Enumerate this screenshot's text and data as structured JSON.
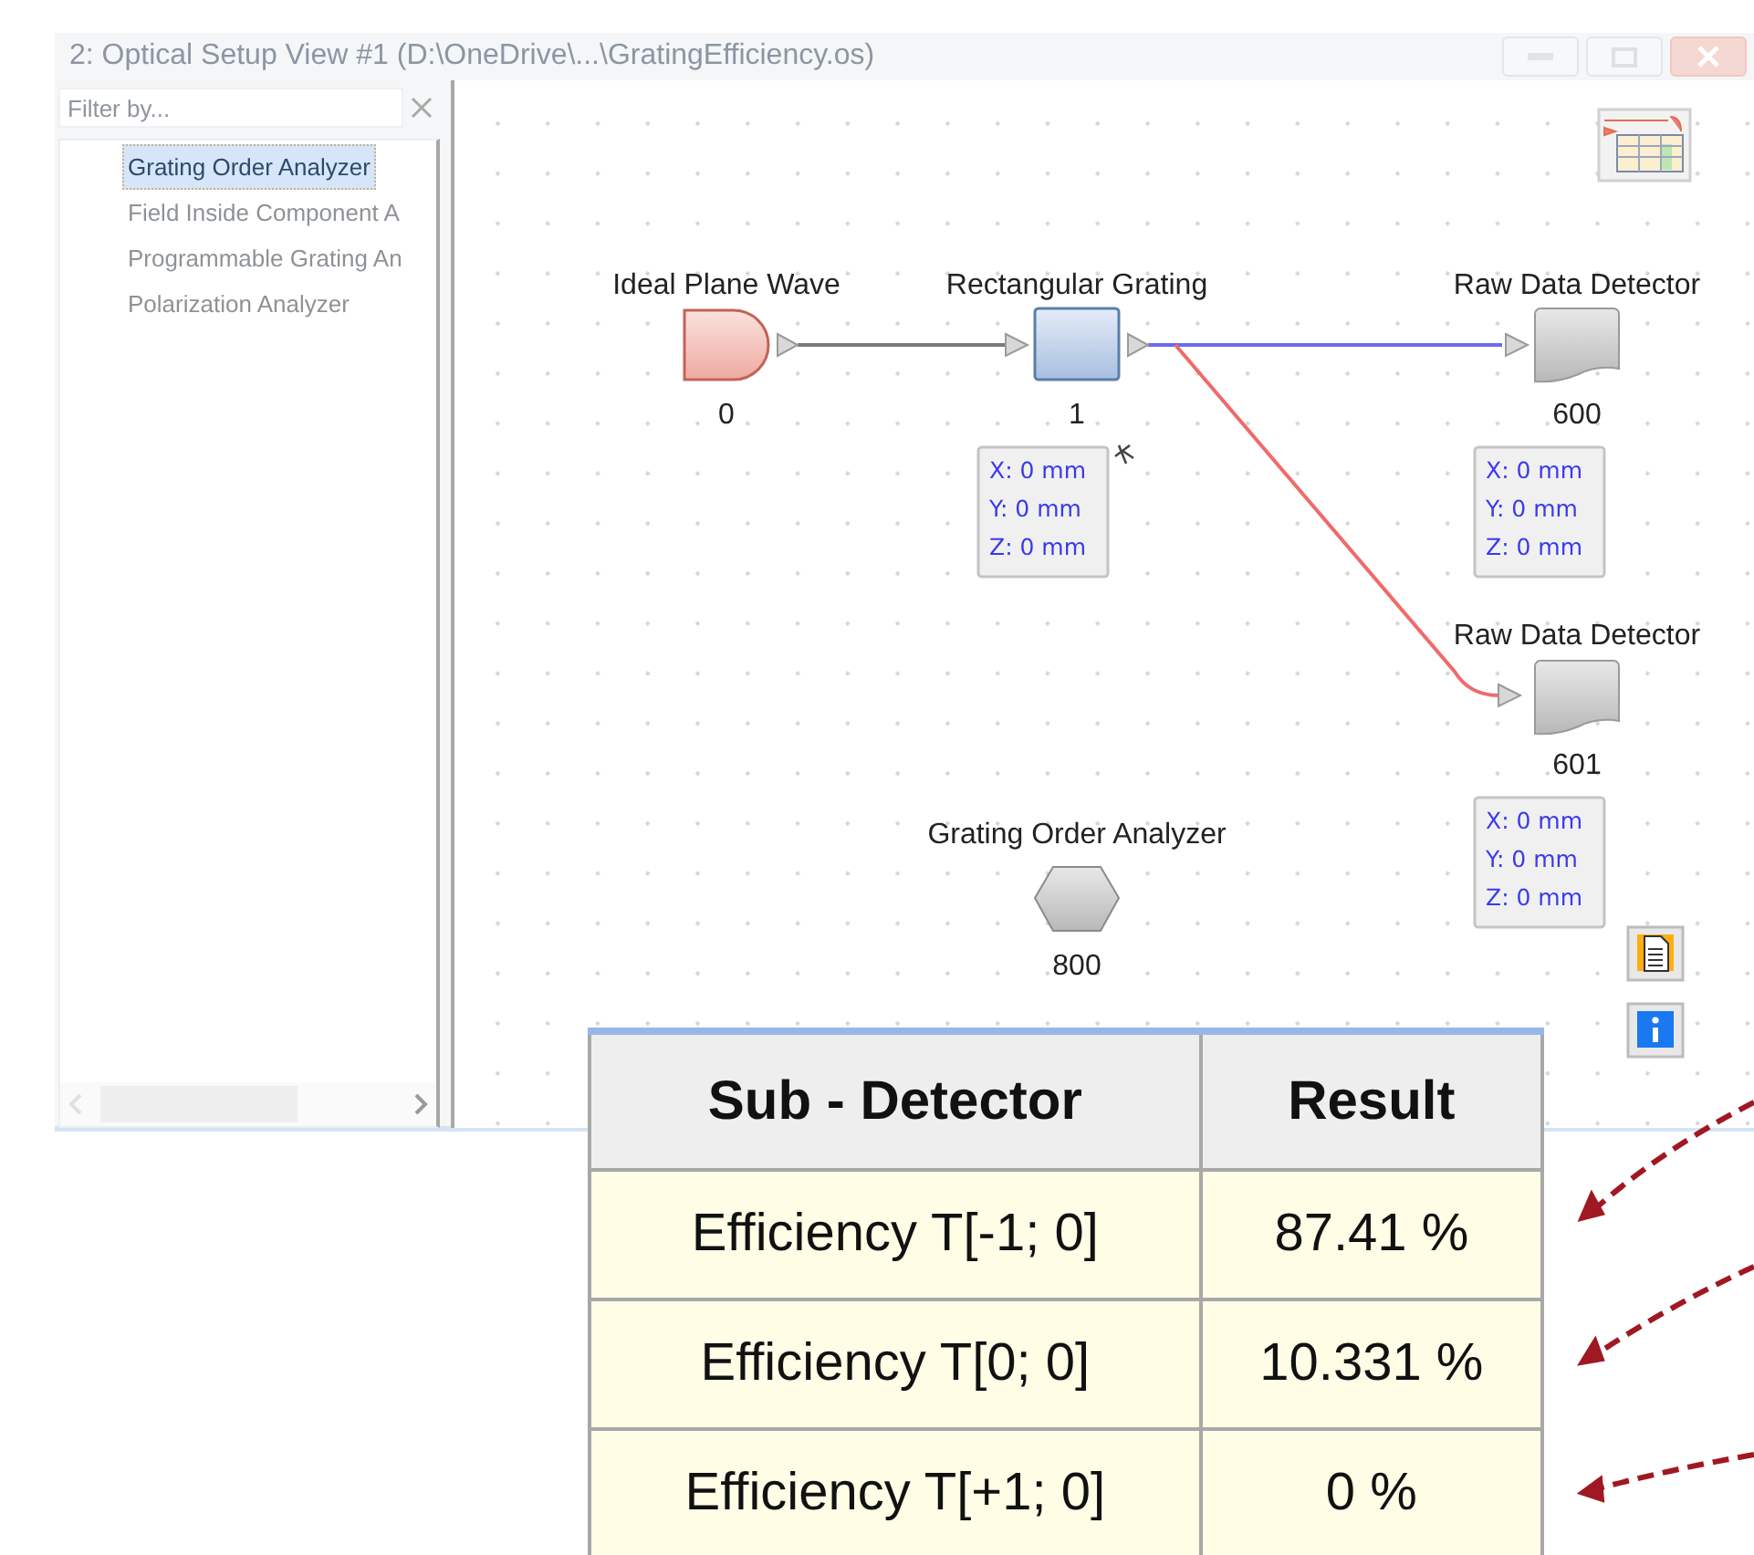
{
  "window": {
    "title": "2: Optical Setup View #1 (D:\\OneDrive\\...\\GratingEfficiency.os)"
  },
  "filter": {
    "placeholder": "Filter by..."
  },
  "tree": [
    {
      "label": "Grating Order Analyzer",
      "selected": true
    },
    {
      "label": "Field Inside Component A",
      "selected": false
    },
    {
      "label": "Programmable Grating An",
      "selected": false
    },
    {
      "label": "Polarization Analyzer",
      "selected": false
    }
  ],
  "diagram": {
    "nodes": [
      {
        "kind": "source",
        "label": "Ideal Plane Wave",
        "number": "0"
      },
      {
        "kind": "grating",
        "label": "Rectangular Grating",
        "number": "1",
        "position": [
          "X: 0 mm",
          "Y: 0 mm",
          "Z: 0 mm"
        ]
      },
      {
        "kind": "detector",
        "label": "Raw Data Detector",
        "number": "600",
        "position": [
          "X: 0 mm",
          "Y: 0 mm",
          "Z: 0 mm"
        ]
      },
      {
        "kind": "detector",
        "label": "Raw Data Detector",
        "number": "601",
        "position": [
          "X: 0 mm",
          "Y: 0 mm",
          "Z: 0 mm"
        ]
      },
      {
        "kind": "analyzer",
        "label": "Grating Order Analyzer",
        "number": "800"
      }
    ],
    "connections": [
      {
        "color": "#7a7a7a"
      },
      {
        "color": "#6a6af0"
      },
      {
        "color": "#f06a6a"
      }
    ]
  },
  "results_table": {
    "columns": [
      "Sub - Detector",
      "Result"
    ],
    "rows": [
      [
        "Efficiency T[-1; 0]",
        "87.41 %"
      ],
      [
        "Efficiency T[0; 0]",
        "10.331 %"
      ],
      [
        "Efficiency T[+1; 0]",
        "0 %"
      ]
    ]
  }
}
